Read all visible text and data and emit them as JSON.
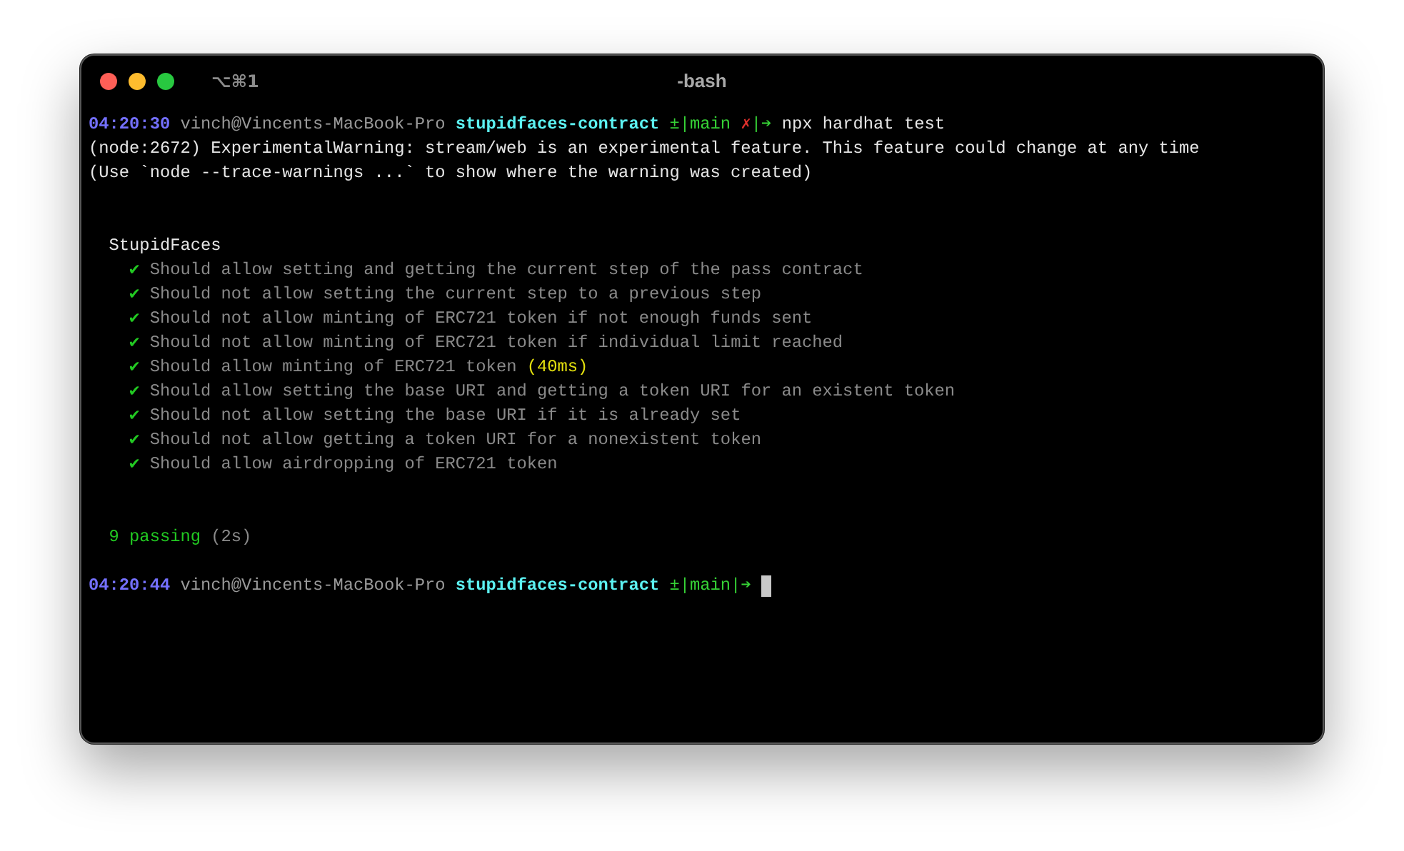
{
  "window": {
    "title": "-bash",
    "shortcut": "⌥⌘1"
  },
  "lines": [
    {
      "kind": "text",
      "segments": [
        {
          "text": "04:20:30",
          "color": "#7470ff",
          "bold": true
        },
        {
          "text": " vinch@Vincents-MacBook-Pro ",
          "color": "#9a9a9a"
        },
        {
          "text": "stupidfaces-contract",
          "color": "#5cf2f2",
          "bold": true
        },
        {
          "text": " ±|main ",
          "color": "#36d236"
        },
        {
          "text": "✗",
          "color": "#e0302c"
        },
        {
          "text": "|➔ ",
          "color": "#36d236"
        },
        {
          "text": "npx hardhat test",
          "color": "#e6e6e6"
        }
      ]
    },
    {
      "kind": "text",
      "segments": [
        {
          "text": "(node:2672) ExperimentalWarning: stream/web is an experimental feature. This feature could change at any time",
          "color": "#e6e6e6"
        }
      ]
    },
    {
      "kind": "text",
      "segments": [
        {
          "text": "(Use `node --trace-warnings ...` to show where the warning was created)",
          "color": "#e6e6e6"
        }
      ]
    },
    {
      "kind": "blank"
    },
    {
      "kind": "blank"
    },
    {
      "kind": "text",
      "segments": [
        {
          "text": "  StupidFaces",
          "color": "#e6e6e6"
        }
      ]
    },
    {
      "kind": "text",
      "segments": [
        {
          "text": "    ✔",
          "color": "#22c922"
        },
        {
          "text": " Should allow setting and getting the current step of the pass contract",
          "color": "#8a8a8a"
        }
      ]
    },
    {
      "kind": "text",
      "segments": [
        {
          "text": "    ✔",
          "color": "#22c922"
        },
        {
          "text": " Should not allow setting the current step to a previous step",
          "color": "#8a8a8a"
        }
      ]
    },
    {
      "kind": "text",
      "segments": [
        {
          "text": "    ✔",
          "color": "#22c922"
        },
        {
          "text": " Should not allow minting of ERC721 token if not enough funds sent",
          "color": "#8a8a8a"
        }
      ]
    },
    {
      "kind": "text",
      "segments": [
        {
          "text": "    ✔",
          "color": "#22c922"
        },
        {
          "text": " Should not allow minting of ERC721 token if individual limit reached",
          "color": "#8a8a8a"
        }
      ]
    },
    {
      "kind": "text",
      "segments": [
        {
          "text": "    ✔",
          "color": "#22c922"
        },
        {
          "text": " Should allow minting of ERC721 token ",
          "color": "#8a8a8a"
        },
        {
          "text": "(40ms)",
          "color": "#e3e00e"
        }
      ]
    },
    {
      "kind": "text",
      "segments": [
        {
          "text": "    ✔",
          "color": "#22c922"
        },
        {
          "text": " Should allow setting the base URI and getting a token URI for an existent token",
          "color": "#8a8a8a"
        }
      ]
    },
    {
      "kind": "text",
      "segments": [
        {
          "text": "    ✔",
          "color": "#22c922"
        },
        {
          "text": " Should not allow setting the base URI if it is already set",
          "color": "#8a8a8a"
        }
      ]
    },
    {
      "kind": "text",
      "segments": [
        {
          "text": "    ✔",
          "color": "#22c922"
        },
        {
          "text": " Should not allow getting a token URI for a nonexistent token",
          "color": "#8a8a8a"
        }
      ]
    },
    {
      "kind": "text",
      "segments": [
        {
          "text": "    ✔",
          "color": "#22c922"
        },
        {
          "text": " Should allow airdropping of ERC721 token",
          "color": "#8a8a8a"
        }
      ]
    },
    {
      "kind": "blank"
    },
    {
      "kind": "blank"
    },
    {
      "kind": "text",
      "segments": [
        {
          "text": "  9 passing",
          "color": "#22c922"
        },
        {
          "text": " (2s)",
          "color": "#8a8a8a"
        }
      ]
    },
    {
      "kind": "blank"
    },
    {
      "kind": "text",
      "cursor": true,
      "segments": [
        {
          "text": "04:20:44",
          "color": "#7470ff",
          "bold": true
        },
        {
          "text": " vinch@Vincents-MacBook-Pro ",
          "color": "#9a9a9a"
        },
        {
          "text": "stupidfaces-contract",
          "color": "#5cf2f2",
          "bold": true
        },
        {
          "text": " ±|main|➔",
          "color": "#36d236"
        }
      ]
    }
  ]
}
